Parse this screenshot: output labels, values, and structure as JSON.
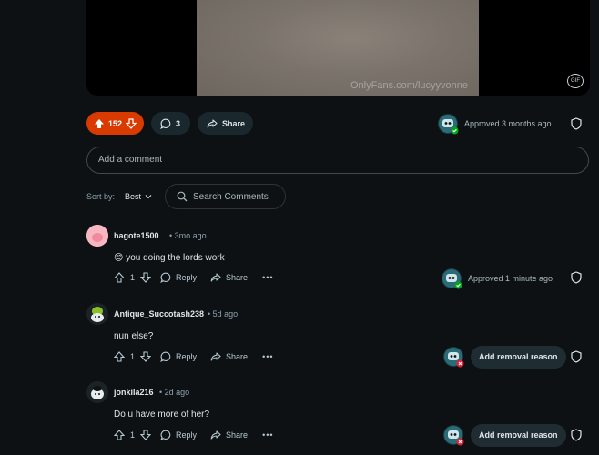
{
  "post": {
    "watermark": "OnlyFans.com/lucyyvonne",
    "gif_badge": "GIF",
    "upvotes": "152",
    "comments": "3",
    "share_label": "Share",
    "approved_text": "Approved 3 months ago",
    "add_comment_placeholder": "Add a comment"
  },
  "sort": {
    "label": "Sort by:",
    "value": "Best",
    "search_placeholder": "Search Comments"
  },
  "comments": [
    {
      "author": "hagote1500",
      "time": "3mo ago",
      "emoji": "😊",
      "text": "you doing the lords work",
      "score": "1",
      "reply": "Reply",
      "share": "Share",
      "mod_status": "Approved 1 minute ago"
    },
    {
      "author": "Antique_Succotash238",
      "time": "5d ago",
      "text": "nun else?",
      "score": "1",
      "reply": "Reply",
      "share": "Share",
      "mod_action": "Add removal reason"
    },
    {
      "author": "jonkila216",
      "time": "2d ago",
      "text": "Do u have more of her?",
      "score": "1",
      "reply": "Reply",
      "share": "Share",
      "mod_action": "Add removal reason"
    }
  ],
  "colors": {
    "background": "#0e1113",
    "upvote_active": "#d93a00",
    "approved_green": "#01a816",
    "removed_red": "#e0213a"
  }
}
